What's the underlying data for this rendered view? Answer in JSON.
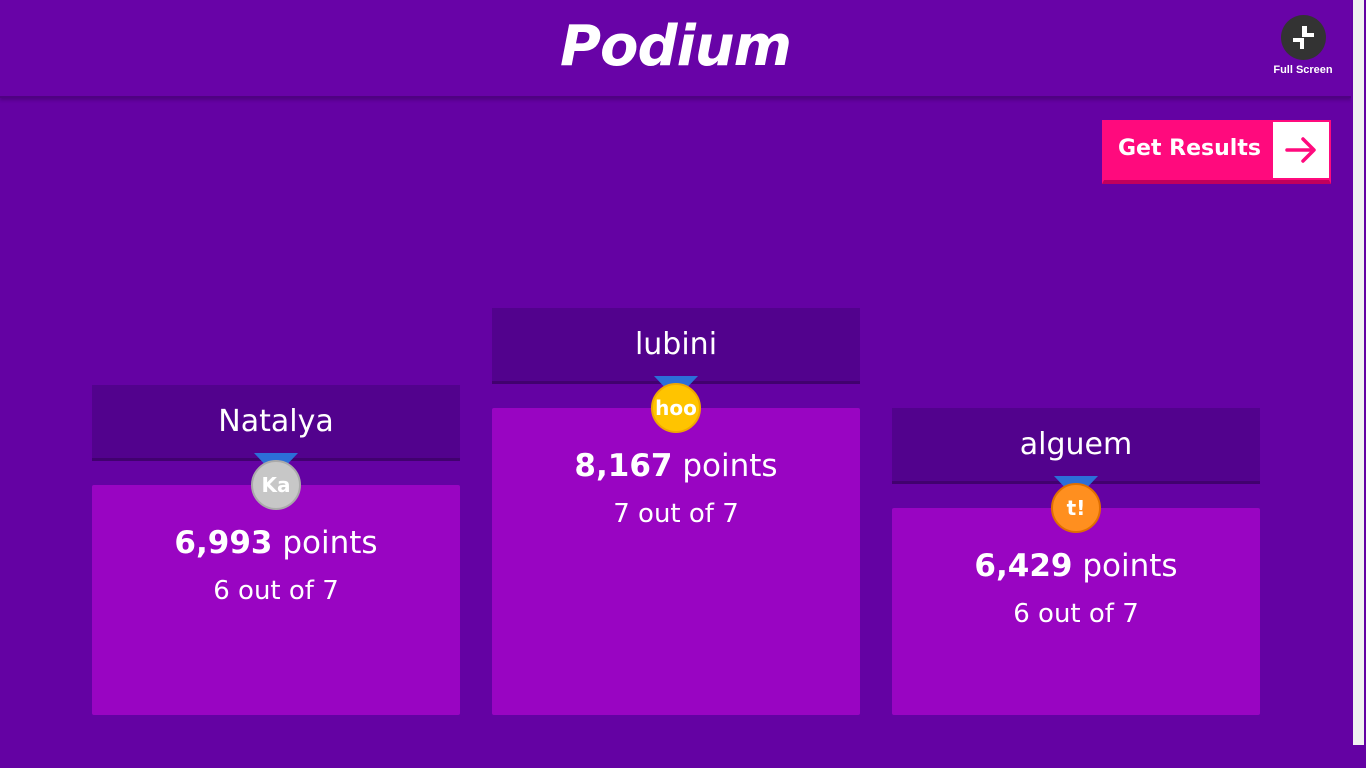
{
  "header": {
    "title": "Podium",
    "fullscreen_label": "Full Screen",
    "fullscreen_icon": "fullscreen-icon"
  },
  "actions": {
    "get_results_label": "Get Results",
    "get_results_icon": "arrow-right-icon"
  },
  "colors": {
    "background": "#6402a3",
    "name_box": "#52028d",
    "score_box": "#9905c2",
    "accent": "#ff0a7d"
  },
  "podium": {
    "second": {
      "name": "Natalya",
      "medal_text": "Ka",
      "medal": "silver",
      "points_value": "6,993",
      "points_unit": "points",
      "correct": "6 out of 7"
    },
    "first": {
      "name": "lubini",
      "medal_text": "hoo",
      "medal": "gold",
      "points_value": "8,167",
      "points_unit": "points",
      "correct": "7 out of 7"
    },
    "third": {
      "name": "alguem",
      "medal_text": "t!",
      "medal": "bronze",
      "points_value": "6,429",
      "points_unit": "points",
      "correct": "6 out of 7"
    }
  }
}
